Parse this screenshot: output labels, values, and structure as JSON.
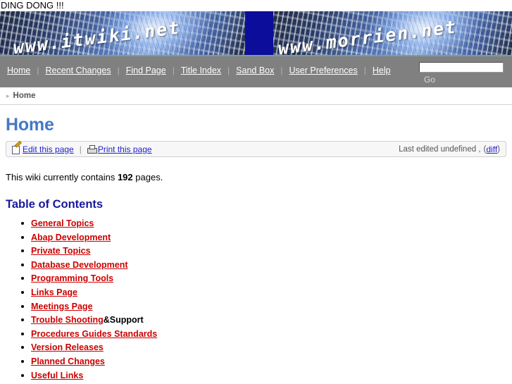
{
  "status_line": "DING DONG !!!",
  "banner": {
    "left_url": "www.itwiki.net",
    "right_url": "www.morrien.net"
  },
  "nav": {
    "items": [
      {
        "label": "Home"
      },
      {
        "label": "Recent Changes"
      },
      {
        "label": "Find Page"
      },
      {
        "label": "Title Index"
      },
      {
        "label": "Sand Box"
      },
      {
        "label": "User Preferences"
      },
      {
        "label": "Help"
      }
    ],
    "separator": "|",
    "search": {
      "value": "",
      "placeholder": "",
      "go_label": "Go"
    }
  },
  "breadcrumb": {
    "arrow": "▸",
    "items": [
      {
        "label": "Home"
      }
    ]
  },
  "page": {
    "title": "Home",
    "actionbar": {
      "edit_label": "Edit this page",
      "print_label": "Print this page",
      "separator": "|",
      "last_edited_text": "Last edited undefined ,",
      "diff_open": "(",
      "diff_label": "diff",
      "diff_close": ")"
    },
    "wiki_count_prefix": "This wiki currently contains ",
    "wiki_count_value": "192",
    "wiki_count_suffix": " pages.",
    "toc_heading": "Table of Contents",
    "toc_items": [
      {
        "label": "General Topics",
        "suffix": ""
      },
      {
        "label": "Abap Development",
        "suffix": ""
      },
      {
        "label": "Private Topics",
        "suffix": ""
      },
      {
        "label": "Database Development",
        "suffix": ""
      },
      {
        "label": "Programming Tools",
        "suffix": ""
      },
      {
        "label": "Links Page",
        "suffix": ""
      },
      {
        "label": "Meetings Page",
        "suffix": ""
      },
      {
        "label": "Trouble Shooting",
        "suffix": "&Support"
      },
      {
        "label": "Procedures Guides Standards",
        "suffix": ""
      },
      {
        "label": "Version Releases",
        "suffix": ""
      },
      {
        "label": "Planned Changes",
        "suffix": ""
      },
      {
        "label": "Useful Links",
        "suffix": ""
      }
    ]
  },
  "colors": {
    "nav_background": "#808080",
    "page_title": "#4479c4",
    "toc_heading": "#18189c",
    "wiki_link": "#cc0000",
    "action_link": "#2222cc",
    "banner_block": "#0d0d9c"
  }
}
